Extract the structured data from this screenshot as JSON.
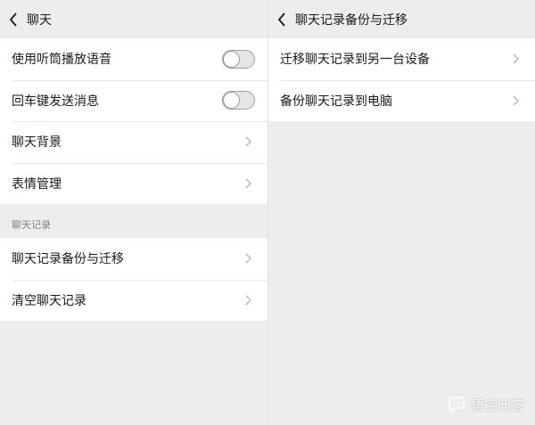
{
  "left_panel": {
    "header": {
      "title": "聊天",
      "back_icon": "chevron-left-icon"
    },
    "group1": [
      {
        "label": "使用听筒播放语音",
        "control": "toggle",
        "on": false
      },
      {
        "label": "回车键发送消息",
        "control": "toggle",
        "on": false
      },
      {
        "label": "聊天背景",
        "control": "chevron"
      },
      {
        "label": "表情管理",
        "control": "chevron"
      }
    ],
    "section_label": "聊天记录",
    "group2": [
      {
        "label": "聊天记录备份与迁移",
        "control": "chevron"
      },
      {
        "label": "清空聊天记录",
        "control": "chevron"
      }
    ]
  },
  "right_panel": {
    "header": {
      "title": "聊天记录备份与迁移",
      "back_icon": "chevron-left-icon"
    },
    "items": [
      {
        "label": "迁移聊天记录到另一台设备",
        "control": "chevron"
      },
      {
        "label": "备份聊天记录到电脑",
        "control": "chevron"
      }
    ]
  },
  "watermark": {
    "text": "悟空问答",
    "icon": "chat-bubble-logo-icon"
  },
  "colors": {
    "background": "#ededed",
    "cell": "#ffffff",
    "text": "#191919",
    "section_label": "#808080",
    "chevron": "#b2b2b2",
    "toggle_off": "#e5e5e5"
  }
}
